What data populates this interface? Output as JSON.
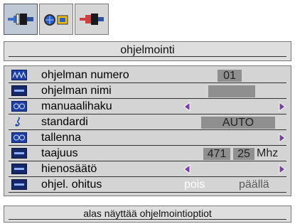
{
  "tabs": [
    {
      "icon": "tuner-plug-icon",
      "active": true
    },
    {
      "icon": "globe-channel-icon",
      "active": false
    },
    {
      "icon": "connector-icon",
      "active": false
    }
  ],
  "title": "ohjelmointi",
  "menu": [
    {
      "label": "ohjelman numero",
      "icon": "wave-icon",
      "value": "01"
    },
    {
      "label": "ohjelman nimi",
      "icon": "name-icon",
      "value": ""
    },
    {
      "label": "manuaalihaku",
      "icon": "search-icon"
    },
    {
      "label": "standardi",
      "icon": "music-note-icon",
      "value": "AUTO"
    },
    {
      "label": "tallenna",
      "icon": "store-icon"
    },
    {
      "label": "taajuus",
      "icon": "frequency-icon",
      "value_major": "471",
      "value_minor": "25",
      "unit": "Mhz"
    },
    {
      "label": "hienosäätö",
      "icon": "fine-tune-icon"
    },
    {
      "label": "ohjel. ohitus",
      "icon": "skip-icon",
      "option_off": "pois",
      "option_on": "päällä"
    }
  ],
  "help": "alas näyttää ohjelmointioptiot",
  "colors": {
    "panel_bg": "#d4d4d4",
    "field_bg": "#8f8f8f",
    "arrow_purple": "#7a3ea8",
    "option_off": "#ffffff",
    "option_on": "#5b5b5b"
  }
}
